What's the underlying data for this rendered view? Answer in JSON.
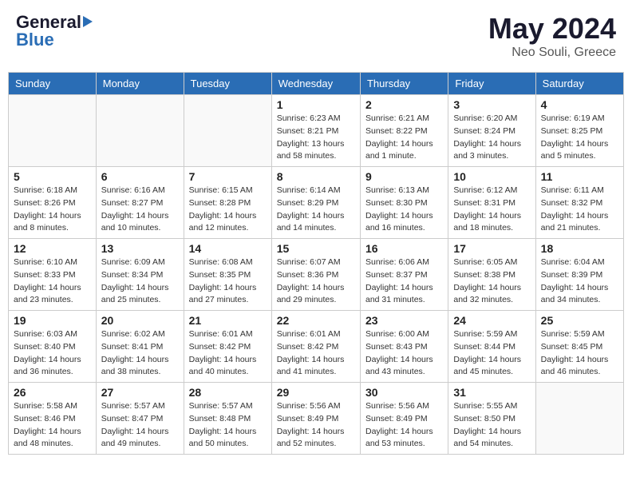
{
  "header": {
    "logo_general": "General",
    "logo_blue": "Blue",
    "month_title": "May 2024",
    "location": "Neo Souli, Greece"
  },
  "weekdays": [
    "Sunday",
    "Monday",
    "Tuesday",
    "Wednesday",
    "Thursday",
    "Friday",
    "Saturday"
  ],
  "weeks": [
    [
      {
        "day": "",
        "info": ""
      },
      {
        "day": "",
        "info": ""
      },
      {
        "day": "",
        "info": ""
      },
      {
        "day": "1",
        "info": "Sunrise: 6:23 AM\nSunset: 8:21 PM\nDaylight: 13 hours and 58 minutes."
      },
      {
        "day": "2",
        "info": "Sunrise: 6:21 AM\nSunset: 8:22 PM\nDaylight: 14 hours and 1 minute."
      },
      {
        "day": "3",
        "info": "Sunrise: 6:20 AM\nSunset: 8:24 PM\nDaylight: 14 hours and 3 minutes."
      },
      {
        "day": "4",
        "info": "Sunrise: 6:19 AM\nSunset: 8:25 PM\nDaylight: 14 hours and 5 minutes."
      }
    ],
    [
      {
        "day": "5",
        "info": "Sunrise: 6:18 AM\nSunset: 8:26 PM\nDaylight: 14 hours and 8 minutes."
      },
      {
        "day": "6",
        "info": "Sunrise: 6:16 AM\nSunset: 8:27 PM\nDaylight: 14 hours and 10 minutes."
      },
      {
        "day": "7",
        "info": "Sunrise: 6:15 AM\nSunset: 8:28 PM\nDaylight: 14 hours and 12 minutes."
      },
      {
        "day": "8",
        "info": "Sunrise: 6:14 AM\nSunset: 8:29 PM\nDaylight: 14 hours and 14 minutes."
      },
      {
        "day": "9",
        "info": "Sunrise: 6:13 AM\nSunset: 8:30 PM\nDaylight: 14 hours and 16 minutes."
      },
      {
        "day": "10",
        "info": "Sunrise: 6:12 AM\nSunset: 8:31 PM\nDaylight: 14 hours and 18 minutes."
      },
      {
        "day": "11",
        "info": "Sunrise: 6:11 AM\nSunset: 8:32 PM\nDaylight: 14 hours and 21 minutes."
      }
    ],
    [
      {
        "day": "12",
        "info": "Sunrise: 6:10 AM\nSunset: 8:33 PM\nDaylight: 14 hours and 23 minutes."
      },
      {
        "day": "13",
        "info": "Sunrise: 6:09 AM\nSunset: 8:34 PM\nDaylight: 14 hours and 25 minutes."
      },
      {
        "day": "14",
        "info": "Sunrise: 6:08 AM\nSunset: 8:35 PM\nDaylight: 14 hours and 27 minutes."
      },
      {
        "day": "15",
        "info": "Sunrise: 6:07 AM\nSunset: 8:36 PM\nDaylight: 14 hours and 29 minutes."
      },
      {
        "day": "16",
        "info": "Sunrise: 6:06 AM\nSunset: 8:37 PM\nDaylight: 14 hours and 31 minutes."
      },
      {
        "day": "17",
        "info": "Sunrise: 6:05 AM\nSunset: 8:38 PM\nDaylight: 14 hours and 32 minutes."
      },
      {
        "day": "18",
        "info": "Sunrise: 6:04 AM\nSunset: 8:39 PM\nDaylight: 14 hours and 34 minutes."
      }
    ],
    [
      {
        "day": "19",
        "info": "Sunrise: 6:03 AM\nSunset: 8:40 PM\nDaylight: 14 hours and 36 minutes."
      },
      {
        "day": "20",
        "info": "Sunrise: 6:02 AM\nSunset: 8:41 PM\nDaylight: 14 hours and 38 minutes."
      },
      {
        "day": "21",
        "info": "Sunrise: 6:01 AM\nSunset: 8:42 PM\nDaylight: 14 hours and 40 minutes."
      },
      {
        "day": "22",
        "info": "Sunrise: 6:01 AM\nSunset: 8:42 PM\nDaylight: 14 hours and 41 minutes."
      },
      {
        "day": "23",
        "info": "Sunrise: 6:00 AM\nSunset: 8:43 PM\nDaylight: 14 hours and 43 minutes."
      },
      {
        "day": "24",
        "info": "Sunrise: 5:59 AM\nSunset: 8:44 PM\nDaylight: 14 hours and 45 minutes."
      },
      {
        "day": "25",
        "info": "Sunrise: 5:59 AM\nSunset: 8:45 PM\nDaylight: 14 hours and 46 minutes."
      }
    ],
    [
      {
        "day": "26",
        "info": "Sunrise: 5:58 AM\nSunset: 8:46 PM\nDaylight: 14 hours and 48 minutes."
      },
      {
        "day": "27",
        "info": "Sunrise: 5:57 AM\nSunset: 8:47 PM\nDaylight: 14 hours and 49 minutes."
      },
      {
        "day": "28",
        "info": "Sunrise: 5:57 AM\nSunset: 8:48 PM\nDaylight: 14 hours and 50 minutes."
      },
      {
        "day": "29",
        "info": "Sunrise: 5:56 AM\nSunset: 8:49 PM\nDaylight: 14 hours and 52 minutes."
      },
      {
        "day": "30",
        "info": "Sunrise: 5:56 AM\nSunset: 8:49 PM\nDaylight: 14 hours and 53 minutes."
      },
      {
        "day": "31",
        "info": "Sunrise: 5:55 AM\nSunset: 8:50 PM\nDaylight: 14 hours and 54 minutes."
      },
      {
        "day": "",
        "info": ""
      }
    ]
  ]
}
